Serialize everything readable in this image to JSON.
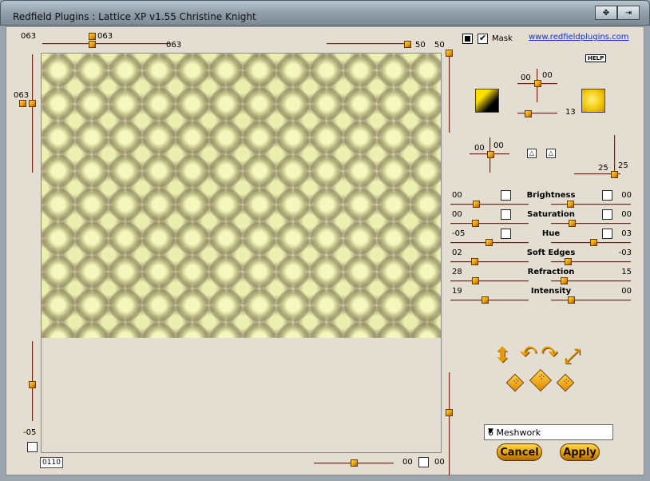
{
  "window": {
    "title": "Redfield Plugins : Lattice XP v1.55   Christine Knight"
  },
  "top": {
    "left_value": "063",
    "slider_value": "063",
    "slider_value2": "063",
    "right_value_a": "50",
    "right_value_b": "50"
  },
  "left": {
    "top_value": "063",
    "bottom_value": "-05"
  },
  "mask": {
    "label": "Mask",
    "checked": true
  },
  "link": {
    "text": "www.redfieldplugins.com"
  },
  "help": {
    "label": "HELP"
  },
  "light": {
    "x": "00",
    "y": "00",
    "z_value": "13"
  },
  "tilt": {
    "x": "00",
    "y": "00",
    "v_a": "25",
    "v_b": "25"
  },
  "adjust": [
    {
      "label": "Brightness",
      "left": "00",
      "right": "00"
    },
    {
      "label": "Saturation",
      "left": "00",
      "right": "00"
    },
    {
      "label": "Hue",
      "left": "-05",
      "right": "03"
    },
    {
      "label": "Soft Edges",
      "left": "02",
      "right": "-03"
    },
    {
      "label": "Refraction",
      "left": "28",
      "right": "15"
    },
    {
      "label": "Intensity",
      "left": "19",
      "right": "00"
    }
  ],
  "preset": {
    "selected": "6 Meshwork"
  },
  "buttons": {
    "cancel": "Cancel",
    "apply": "Apply"
  },
  "bottom": {
    "numbox": "0110",
    "value_a": "00",
    "value_b": "00"
  },
  "icons": {
    "flip": "diamond-flip-icon",
    "rot_left": "rotate-left-icon",
    "rot_right": "rotate-right-icon",
    "expand": "expand-arrow-icon"
  }
}
